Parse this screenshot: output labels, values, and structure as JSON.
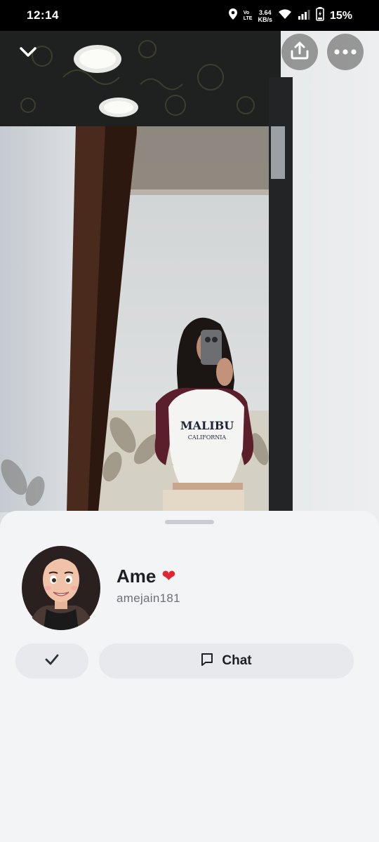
{
  "status_bar": {
    "time": "12:14",
    "lte_top": "Vo",
    "lte_bottom": "LTE",
    "net_speed_value": "3.64",
    "net_speed_unit": "KB/s",
    "battery_percent": "15%"
  },
  "photo": {
    "shirt_text_line1": "MALIBU",
    "shirt_text_line2": "CALIFORNIA"
  },
  "profile": {
    "display_name": "Ame",
    "name_emoji": "❤",
    "username": "amejain181"
  },
  "actions": {
    "check_icon": "checkmark-icon",
    "chat_icon": "chat-bubble-icon",
    "chat_label": "Chat"
  },
  "colors": {
    "sheet_background": "#f3f4f6",
    "button_background": "#e7e9ed",
    "heart": "#e0262e"
  }
}
